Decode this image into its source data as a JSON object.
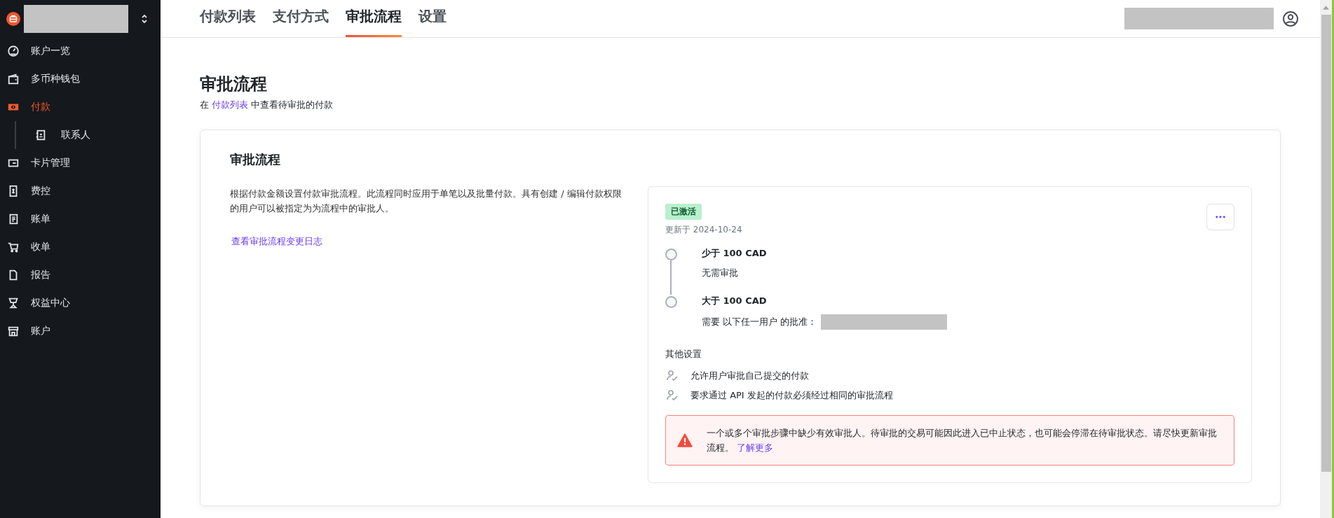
{
  "sidebar": {
    "items": [
      {
        "label": "账户一览",
        "selected": false
      },
      {
        "label": "多币种钱包",
        "selected": false
      },
      {
        "label": "付款",
        "selected": true,
        "children": [
          {
            "label": "联系人",
            "selected": false
          }
        ]
      },
      {
        "label": "卡片管理",
        "selected": false
      },
      {
        "label": "费控",
        "selected": false
      },
      {
        "label": "账单",
        "selected": false
      },
      {
        "label": "收单",
        "selected": false
      },
      {
        "label": "报告",
        "selected": false
      },
      {
        "label": "权益中心",
        "selected": false
      },
      {
        "label": "账户",
        "selected": false
      }
    ]
  },
  "tabs": [
    {
      "label": "付款列表",
      "selected": false
    },
    {
      "label": "支付方式",
      "selected": false
    },
    {
      "label": "审批流程",
      "selected": true
    },
    {
      "label": "设置",
      "selected": false
    }
  ],
  "page": {
    "title": "审批流程",
    "subtitle_prefix": "在",
    "subtitle_link": "付款列表",
    "subtitle_suffix": "中查看待审批的付款"
  },
  "card": {
    "title": "审批流程",
    "description": "根据付款金额设置付款审批流程。此流程同时应用于单笔以及批量付款。具有创建 / 编辑付款权限的用户可以被指定为为流程中的审批人。",
    "changelog_link": "查看审批流程变更日志",
    "policy": {
      "status": "已激活",
      "updated": "更新于 2024-10-24",
      "steps": [
        {
          "title": "少于 100 CAD",
          "detail": "无需审批",
          "redacted": false
        },
        {
          "title": "大于 100 CAD",
          "detail": "需要 以下任一用户 的批准：",
          "redacted": true
        }
      ],
      "other_title": "其他设置",
      "other_settings": [
        "允许用户审批自己提交的付款",
        "要求通过 API 发起的付款必须经过相同的审批流程"
      ],
      "alert": {
        "text": "一个或多个审批步骤中缺少有效审批人。待审批的交易可能因此进入已中止状态，也可能会停滞在待审批状态。请尽快更新审批流程。",
        "link": "了解更多"
      }
    }
  }
}
